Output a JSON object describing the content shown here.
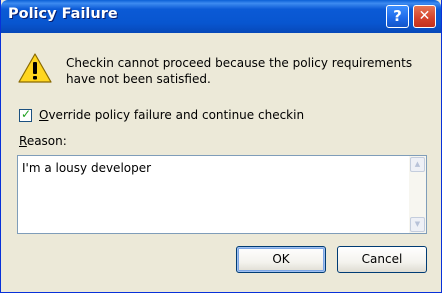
{
  "dialog": {
    "title": "Policy Failure",
    "help_icon": "question-mark-icon",
    "close_icon": "close-x-icon",
    "message": "Checkin cannot proceed because the policy requirements have not been satisfied.",
    "warning_icon": "warning-icon"
  },
  "override": {
    "label_accel": "O",
    "label_rest": "verride policy failure and continue checkin",
    "checked": true,
    "checkmark": "✓"
  },
  "reason": {
    "label_accel": "R",
    "label_rest": "eason:",
    "value": "I'm a lousy developer"
  },
  "buttons": {
    "ok": "OK",
    "cancel": "Cancel"
  },
  "colors": {
    "titlebar": "#0856D0",
    "dialog_bg": "#ECE9D8",
    "close_red": "#D4422A",
    "warning_yellow": "#FFD61F"
  }
}
